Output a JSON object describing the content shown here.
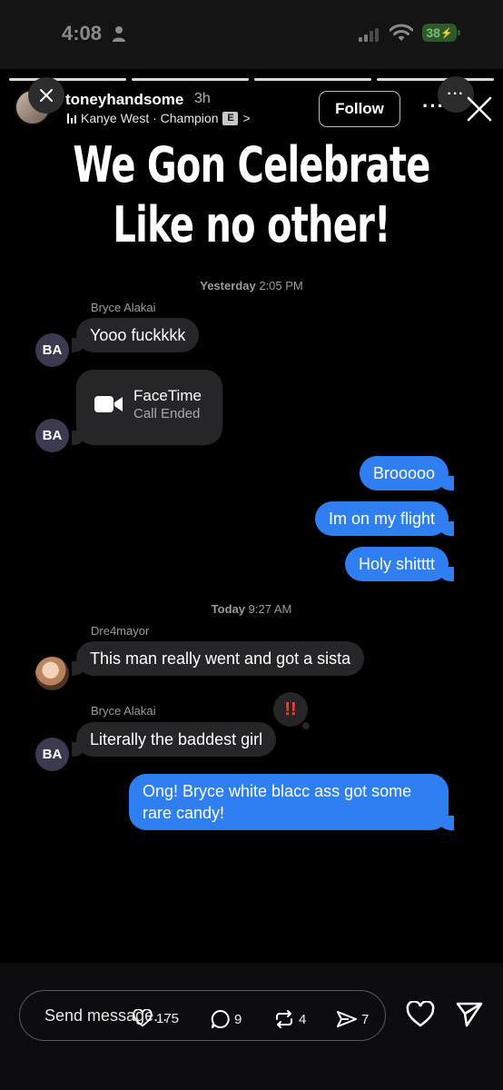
{
  "status_bar": {
    "time": "4:08",
    "battery": "38"
  },
  "story": {
    "username": "toneyhandsome",
    "time_ago": "3h",
    "music": "Kanye West · Champion",
    "explicit_badge": "E",
    "chevron": ">",
    "follow_label": "Follow",
    "more_label": "···",
    "progress_segments": [
      true,
      true,
      true,
      true
    ]
  },
  "headline": {
    "line1": "We Gon Celebrate",
    "line2": "Like no other!"
  },
  "chat": {
    "stamp_yesterday": {
      "day": "Yesterday",
      "time": "2:05 PM"
    },
    "sender_1": "Bryce Alakai",
    "avatar_initials": "BA",
    "msg_1": "Yooo fuckkkk",
    "facetime": {
      "title": "FaceTime",
      "subtitle": "Call Ended"
    },
    "out_1": "Brooooo",
    "out_2": "Im on my flight",
    "out_3": "Holy shitttt",
    "stamp_today": {
      "day": "Today",
      "time": "9:27 AM"
    },
    "sender_2": "Dre4mayor",
    "msg_2": "This man really went and got a sista",
    "sender_3": "Bryce Alakai",
    "reaction": "!!",
    "msg_3": "Literally the baddest girl",
    "out_4": "Ong! Bryce white blacc ass got some rare candy!"
  },
  "bottom_bar": {
    "placeholder": "Send message...",
    "likes": "175",
    "comments": "9",
    "reposts": "4",
    "shares": "7"
  },
  "colors": {
    "outgoing_bubble": "#2f7ff2",
    "incoming_bubble": "#262628",
    "background": "#000000"
  }
}
